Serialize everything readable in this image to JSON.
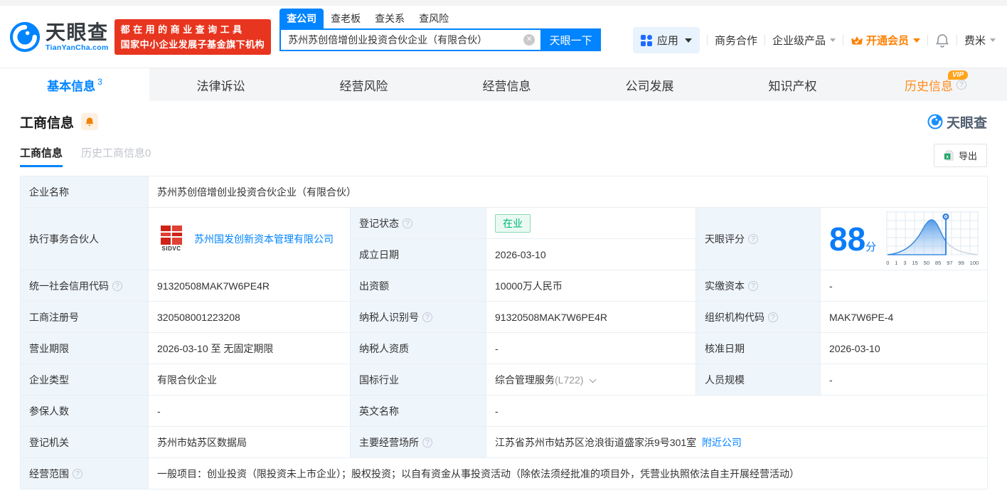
{
  "brand": {
    "name": "天眼查",
    "domain": "TianYanCha.com",
    "slogan1": "都在用的商业查询工具",
    "slogan2": "国家中小企业发展子基金旗下机构"
  },
  "search": {
    "tabs": [
      "查公司",
      "查老板",
      "查关系",
      "查风险"
    ],
    "value": "苏州苏创倍增创业投资合伙企业（有限合伙）",
    "button": "天眼一下"
  },
  "menu": {
    "apps": "应用",
    "cooperation": "商务合作",
    "enterprise": "企业级产品",
    "vip": "开通会员",
    "user": "费米"
  },
  "nav": {
    "tab1": "基本信息",
    "tab1_count": "3",
    "tab2": "法律诉讼",
    "tab3": "经营风险",
    "tab4": "经营信息",
    "tab5": "公司发展",
    "tab6": "知识产权",
    "tab7": "历史信息",
    "vip_badge": "VIP"
  },
  "section": {
    "title": "工商信息",
    "watermark": "天眼查",
    "subtab1": "工商信息",
    "subtab2": "历史工商信息0",
    "export": "导出"
  },
  "company": {
    "name_label": "企业名称",
    "name": "苏州苏创倍增创业投资合伙企业（有限合伙）",
    "partner_label": "执行事务合伙人",
    "partner": "苏州国发创新资本管理有限公司",
    "partner_logo": "SIDVC",
    "status_label": "登记状态",
    "status": "在业",
    "established_label": "成立日期",
    "established": "2026-03-10",
    "credit_code_label": "统一社会信用代码",
    "credit_code": "91320508MAK7W6PE4R",
    "capital_label": "出资额",
    "capital": "10000万人民币",
    "paid_capital_label": "实缴资本",
    "paid_capital": "-",
    "reg_number_label": "工商注册号",
    "reg_number": "320508001223208",
    "taxpayer_id_label": "纳税人识别号",
    "taxpayer_id": "91320508MAK7W6PE4R",
    "org_code_label": "组织机构代码",
    "org_code": "MAK7W6PE-4",
    "term_label": "营业期限",
    "term": "2026-03-10 至 无固定期限",
    "taxpayer_quality_label": "纳税人资质",
    "taxpayer_quality": "-",
    "approval_label": "核准日期",
    "approval": "2026-03-10",
    "type_label": "企业类型",
    "type": "有限合伙企业",
    "industry_label": "国标行业",
    "industry": "综合管理服务",
    "industry_code": "(L722)",
    "staff_label": "人员规模",
    "staff": "-",
    "insured_label": "参保人数",
    "insured": "-",
    "english_label": "英文名称",
    "english": "-",
    "authority_label": "登记机关",
    "authority": "苏州市姑苏区数据局",
    "address_label": "主要经营场所",
    "address": "江苏省苏州市姑苏区沧浪街道盛家浜9号301室",
    "nearby": "附近公司",
    "scope_label": "经营范围",
    "scope": "一般项目：创业投资（限投资未上市企业）；股权投资；以自有资金从事投资活动（除依法须经批准的项目外，凭营业执照依法自主开展经营活动）"
  },
  "score": {
    "label": "天眼评分",
    "value": "88",
    "unit": "分",
    "ticks": [
      "0",
      "1",
      "3",
      "15",
      "50",
      "85",
      "97",
      "99",
      "100"
    ]
  }
}
